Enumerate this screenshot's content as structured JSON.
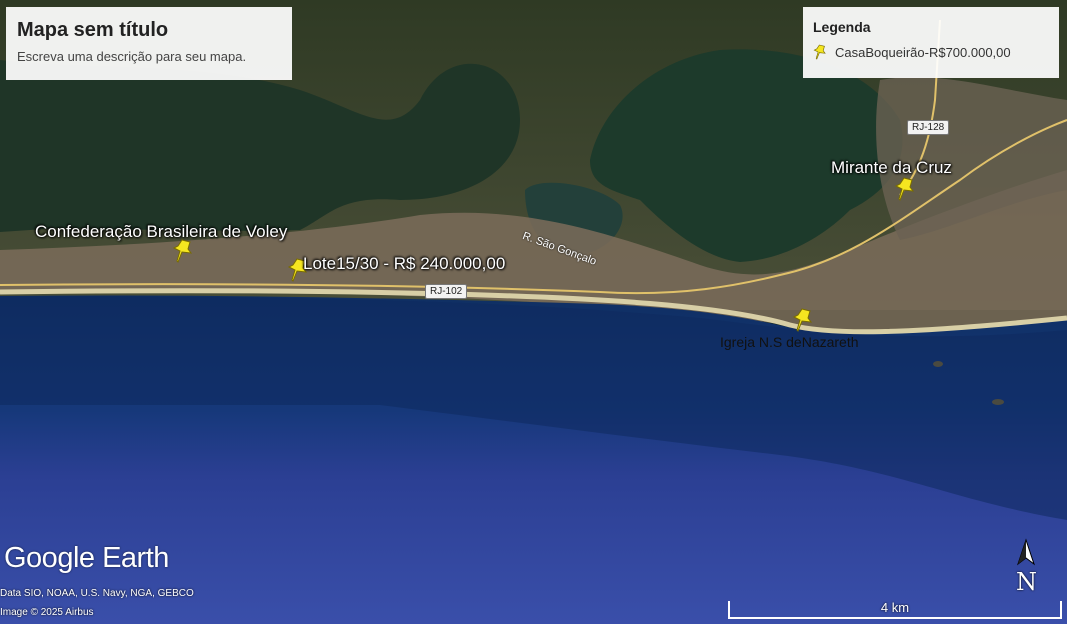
{
  "map": {
    "title": "Mapa sem título",
    "description": "Escreva uma descrição para seu mapa."
  },
  "legend": {
    "title": "Legenda",
    "items": [
      {
        "label": "CasaBoqueirão-R$700.000,00",
        "icon": "yellow-pushpin-icon"
      }
    ]
  },
  "placemarks": [
    {
      "label": "Confederação Brasileira de Voley",
      "icon": "yellow-pushpin-icon"
    },
    {
      "label": "Lote15/30 - R$ 240.000,00",
      "icon": "yellow-pushpin-icon"
    },
    {
      "label": "Mirante da Cruz",
      "icon": "yellow-pushpin-icon"
    },
    {
      "label": "Igreja N.S deNazareth",
      "icon": "yellow-pushpin-icon"
    }
  ],
  "roads": {
    "rj102": "RJ-102",
    "rj128": "RJ-128",
    "street": "R. São Gonçalo"
  },
  "branding": {
    "logo": "Google Earth",
    "credit_data": "Data SIO, NOAA, U.S. Navy, NGA, GEBCO",
    "credit_image": "Image © 2025 Airbus"
  },
  "compass": {
    "label": "N"
  },
  "scale": {
    "label": "4 km"
  },
  "colors": {
    "pin": "#f5e620",
    "ocean_near": "#123a78",
    "ocean_far": "#2e4aa0",
    "lagoon": "#1e3d2e",
    "land": "#3d4a2e",
    "beach": "#d8cfa6"
  }
}
